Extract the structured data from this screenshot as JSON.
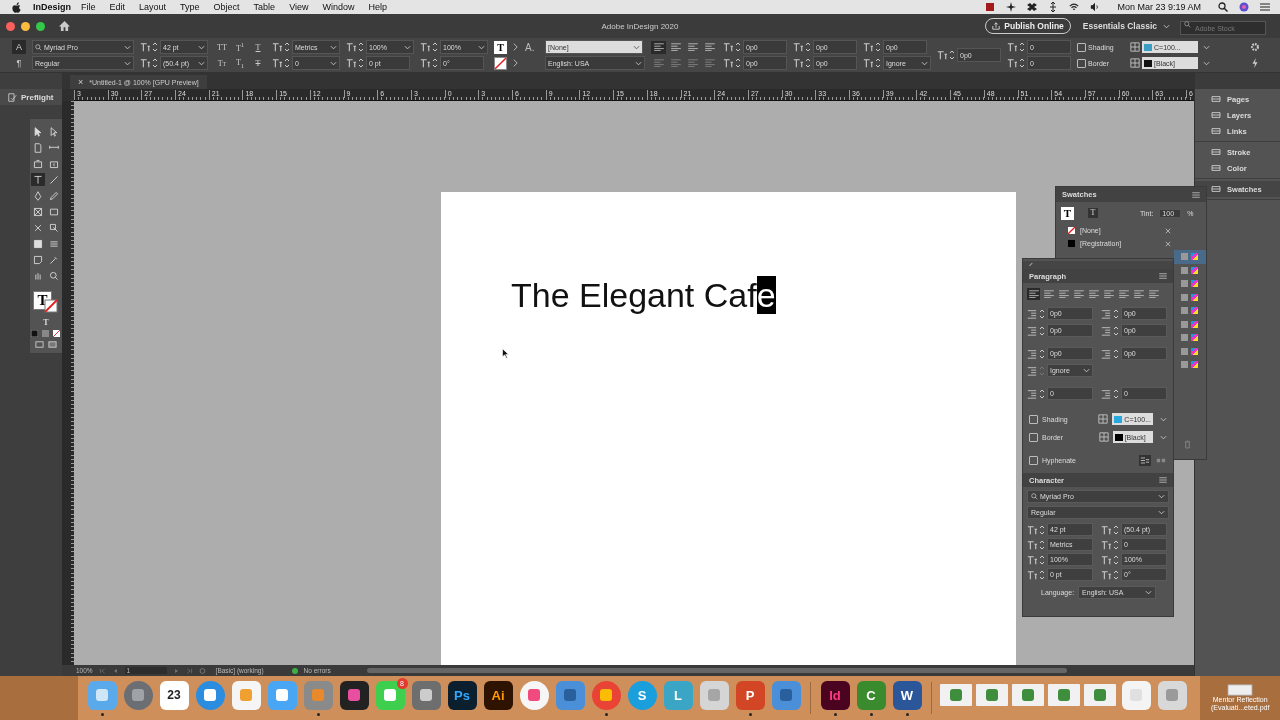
{
  "menu_bar": {
    "app": "InDesign",
    "menus": [
      "File",
      "Edit",
      "Layout",
      "Type",
      "Object",
      "Table",
      "View",
      "Window",
      "Help"
    ],
    "clock": "Mon Mar 23  9:19 AM"
  },
  "title_bar": {
    "title": "Adobe InDesign 2020",
    "publish": "Publish Online",
    "workspace": "Essentials Classic",
    "search_placeholder": "Adobe Stock"
  },
  "control_bar": {
    "columns": [
      {
        "top": {
          "kind": "toggle",
          "label": "A",
          "selected": true
        },
        "bottom": {
          "kind": "toggle",
          "label": "¶",
          "selected": false
        }
      },
      {
        "top": {
          "kind": "font",
          "value": "Myriad Pro"
        },
        "bottom": {
          "kind": "dropdown",
          "value": "Regular"
        }
      },
      {
        "top": {
          "kind": "spin-menu",
          "value": "42 pt"
        },
        "bottom": {
          "kind": "spin-menu",
          "value": "(50.4 pt)"
        }
      },
      {
        "top": {
          "kind": "styles",
          "buttons": [
            {
              "kind": "caps",
              "label": "TT"
            },
            {
              "kind": "super",
              "label": "T$^{1}$"
            },
            {
              "kind": "underline",
              "label": "T"
            }
          ]
        },
        "bottom": {
          "kind": "styles",
          "buttons": [
            {
              "kind": "smallcaps",
              "label": "Tт"
            },
            {
              "kind": "sub",
              "label": "T$_{1}$"
            },
            {
              "kind": "strike",
              "label": "T"
            }
          ]
        }
      },
      {
        "top": {
          "kind": "spin-menu",
          "value": "Metrics"
        },
        "bottom": {
          "kind": "spin-menu",
          "value": "0"
        }
      },
      {
        "top": {
          "kind": "spin-menu",
          "value": "100%"
        },
        "bottom": {
          "kind": "spin",
          "value": "0 pt"
        }
      },
      {
        "top": {
          "kind": "spin-menu",
          "value": "100%"
        },
        "bottom": {
          "kind": "spin",
          "value": "0°"
        }
      },
      {
        "top": {
          "kind": "fill",
          "label": "T"
        },
        "bottom": {
          "kind": "stroke"
        }
      },
      {
        "top": {
          "kind": "charstyle",
          "label": "A.",
          "value": "[None]"
        },
        "bottom": {
          "kind": "language",
          "value": "English: USA"
        }
      },
      {
        "top": {
          "kind": "align",
          "buttons": [
            {
              "selected": true
            },
            {
              "selected": false
            },
            {
              "selected": false
            },
            {
              "selected": false
            }
          ]
        },
        "bottom": {
          "kind": "align",
          "buttons": [
            {
              "selected": false
            },
            {
              "selected": false
            },
            {
              "selected": false
            },
            {
              "selected": false
            }
          ]
        }
      },
      {
        "top": {
          "kind": "spin",
          "value": "0p0"
        },
        "bottom": {
          "kind": "spin",
          "value": "0p0"
        }
      },
      {
        "top": {
          "kind": "spin",
          "value": "0p0"
        },
        "bottom": {
          "kind": "spin",
          "value": "0p0"
        }
      },
      {
        "top": {
          "kind": "spin",
          "value": "0p0"
        },
        "bottom": {
          "kind": "spin-menu",
          "value": "Ignore"
        }
      },
      {
        "top": {
          "kind": "spin",
          "value": "0p0"
        }
      },
      {
        "top": {
          "kind": "spin",
          "value": "0"
        },
        "bottom": {
          "kind": "spin",
          "value": "0"
        }
      },
      {
        "top": {
          "kind": "check",
          "label": "Shading",
          "checked": false
        },
        "bottom": {
          "kind": "check",
          "label": "Border",
          "checked": false
        }
      },
      {
        "top": {
          "kind": "color",
          "value": "C=100...",
          "color": "#3b9ec4"
        },
        "bottom": {
          "kind": "color",
          "value": "[Black]",
          "color": "#111111"
        }
      }
    ]
  },
  "document_tab": {
    "close": "×",
    "title": "*Untitled-1 @ 100% [GPU Preview]"
  },
  "preflight": "Preflight",
  "ruler": {
    "labels": [
      "3",
      "30",
      "27",
      "24",
      "21",
      "18",
      "15",
      "12",
      "9",
      "6",
      "3",
      "0",
      "3",
      "6",
      "9",
      "12",
      "15",
      "18",
      "21",
      "24",
      "27",
      "30",
      "33",
      "36",
      "39",
      "42",
      "45",
      "48",
      "51",
      "54",
      "57",
      "60",
      "63",
      "6"
    ]
  },
  "tools": [
    {
      "kind": "selection",
      "selected": false
    },
    {
      "kind": "direct",
      "selected": false
    },
    {
      "kind": "page",
      "selected": false
    },
    {
      "kind": "gap",
      "selected": false
    },
    {
      "kind": "collector",
      "selected": false
    },
    {
      "kind": "placer",
      "selected": false
    },
    {
      "kind": "type",
      "selected": true
    },
    {
      "kind": "line",
      "selected": false
    },
    {
      "kind": "pen",
      "selected": false
    },
    {
      "kind": "pencil",
      "selected": false
    },
    {
      "kind": "frame",
      "selected": false
    },
    {
      "kind": "rect",
      "selected": false
    },
    {
      "kind": "scissors",
      "selected": false
    },
    {
      "kind": "transform",
      "selected": false
    },
    {
      "kind": "gradient",
      "selected": false
    },
    {
      "kind": "feather",
      "selected": false
    },
    {
      "kind": "note",
      "selected": false
    },
    {
      "kind": "eyedropper",
      "selected": false
    },
    {
      "kind": "hand",
      "selected": false
    },
    {
      "kind": "zoom",
      "selected": false
    }
  ],
  "fill_stroke": {
    "label": "T",
    "small_label": "T"
  },
  "headline": {
    "text": "The Elegant Caf",
    "selection": "e"
  },
  "swatches_panel": {
    "title": "Swatches",
    "fill_label": "T",
    "text_toggle": "T",
    "tint_label": "Tint:",
    "tint": "100",
    "percent": "%",
    "rows": [
      {
        "name": "[None]",
        "kind": "none"
      },
      {
        "name": "[Registration]",
        "kind": "registration"
      }
    ],
    "covered_rows": [
      {
        "selected": true
      },
      {
        "selected": false
      },
      {
        "selected": false
      },
      {
        "selected": false
      },
      {
        "selected": false
      },
      {
        "selected": false
      },
      {
        "selected": false
      },
      {
        "selected": false
      },
      {
        "selected": false
      }
    ]
  },
  "paragraph_panel": {
    "title": "Paragraph",
    "alignments": [
      {
        "selected": true
      },
      {
        "selected": false
      },
      {
        "selected": false
      },
      {
        "selected": false
      },
      {
        "selected": false
      },
      {
        "selected": false
      },
      {
        "selected": false
      },
      {
        "selected": false
      },
      {
        "selected": false
      }
    ],
    "indents": [
      [
        "0p0",
        "0p0"
      ],
      [
        "0p0",
        "0p0"
      ],
      [
        "0p0",
        "0p0"
      ]
    ],
    "grid": "Ignore",
    "drop_caps": [
      "0",
      "0"
    ],
    "shading": {
      "label": "Shading",
      "checked": false,
      "swatch": "C=100...",
      "color": "#29a8e0"
    },
    "border": {
      "label": "Border",
      "checked": false,
      "swatch": "[Black]",
      "color": "#000000"
    },
    "hyphenate": {
      "label": "Hyphenate",
      "checked": false
    }
  },
  "character_panel": {
    "title": "Character",
    "font": "Myriad Pro",
    "style": "Regular",
    "fields": [
      [
        "42 pt",
        "(50.4 pt)"
      ],
      [
        "Metrics",
        "0"
      ],
      [
        "100%",
        "100%"
      ],
      [
        "0 pt",
        "0°"
      ]
    ],
    "language_label": "Language:",
    "language": "English: USA"
  },
  "panel_dock": {
    "groups": [
      [
        {
          "label": "Pages",
          "selected": false
        },
        {
          "label": "Layers",
          "selected": false
        },
        {
          "label": "Links",
          "selected": false
        }
      ],
      [
        {
          "label": "Stroke",
          "selected": false
        },
        {
          "label": "Color",
          "selected": false
        }
      ],
      [
        {
          "label": "Swatches",
          "selected": true
        }
      ]
    ]
  },
  "status_bar": {
    "zoom": "100%",
    "page": "1",
    "profile": "[Basic] (working)",
    "errors": "No errors"
  },
  "dock": {
    "items": [
      {
        "kind": "finder",
        "running": true
      },
      {
        "kind": "launchpad",
        "running": false
      },
      {
        "kind": "calendar",
        "label": "23",
        "running": false
      },
      {
        "kind": "safari",
        "running": false
      },
      {
        "kind": "reminders",
        "running": false
      },
      {
        "kind": "messages",
        "running": false
      },
      {
        "kind": "calculator",
        "running": true
      },
      {
        "kind": "video",
        "running": false
      },
      {
        "kind": "facetime",
        "badge": "8",
        "running": false
      },
      {
        "kind": "gear",
        "running": false
      },
      {
        "kind": "ps",
        "label": "Ps",
        "running": false
      },
      {
        "kind": "ai",
        "label": "Ai",
        "running": false
      },
      {
        "kind": "music",
        "running": false
      },
      {
        "kind": "kite",
        "running": false
      },
      {
        "kind": "chrome",
        "running": true
      },
      {
        "kind": "skype",
        "label": "S",
        "running": false
      },
      {
        "kind": "lens",
        "label": "L",
        "running": false
      },
      {
        "kind": "cube",
        "running": false
      },
      {
        "kind": "ppt",
        "label": "P",
        "running": true
      },
      {
        "kind": "kite",
        "running": false
      },
      {
        "kind": "sep"
      },
      {
        "kind": "id",
        "label": "Id",
        "running": true
      },
      {
        "kind": "camtasia",
        "label": "C",
        "running": true
      },
      {
        "kind": "word",
        "label": "W",
        "running": true
      },
      {
        "kind": "sep"
      },
      {
        "kind": "thumb",
        "running": false
      },
      {
        "kind": "thumb",
        "running": false
      },
      {
        "kind": "thumb",
        "running": false
      },
      {
        "kind": "thumb",
        "running": false
      },
      {
        "kind": "thumb",
        "running": false
      },
      {
        "kind": "blank",
        "running": false
      },
      {
        "kind": "trash",
        "running": false
      }
    ],
    "file": "Mentor Reflection (Evaluati...eted.pdf"
  }
}
